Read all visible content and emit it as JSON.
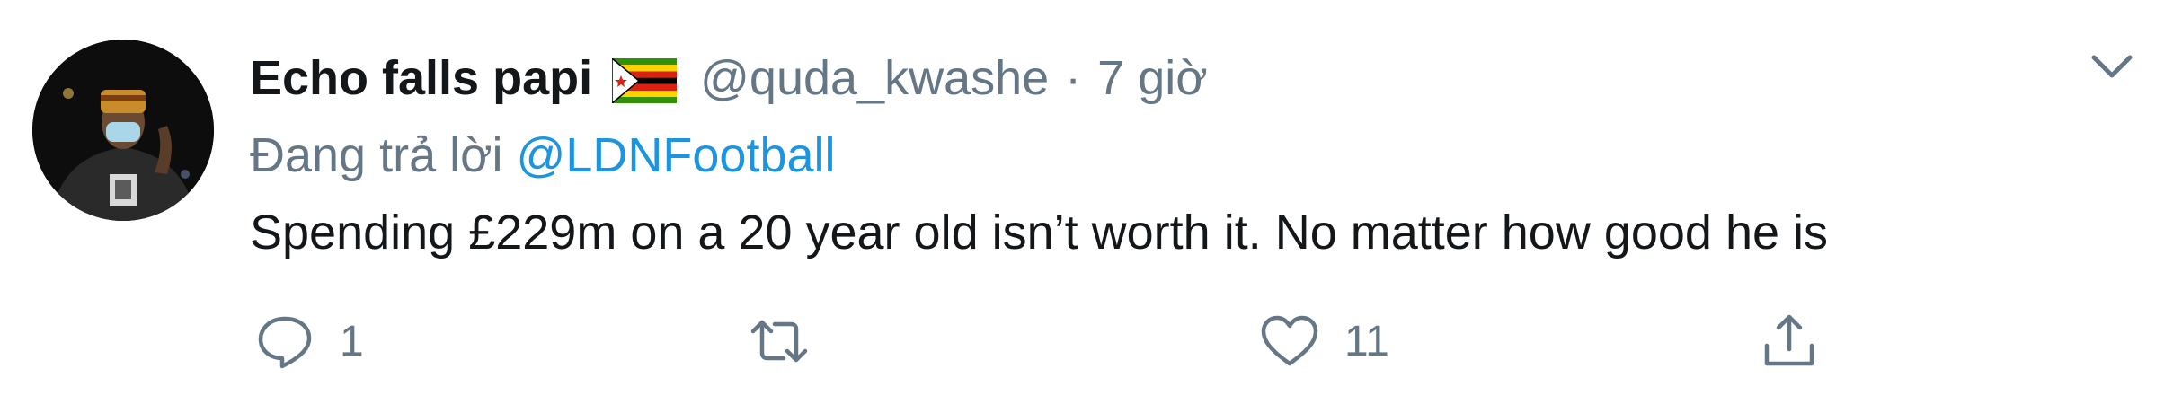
{
  "tweet": {
    "display_name": "Echo falls papi",
    "flag_emoji_name": "zimbabwe-flag",
    "handle": "@quda_kwashe",
    "separator": "·",
    "time": "7 giờ",
    "reply_prefix": "Đang trả lời",
    "reply_to": "@LDNFootball",
    "text": "Spending £229m on a 20 year old isn’t worth it. No matter how good he is",
    "actions": {
      "reply_count": "1",
      "retweet_count": "",
      "like_count": "11"
    }
  },
  "colors": {
    "text_primary": "#14171a",
    "text_secondary": "#657786",
    "link": "#1b95e0",
    "icon": "#657786"
  }
}
